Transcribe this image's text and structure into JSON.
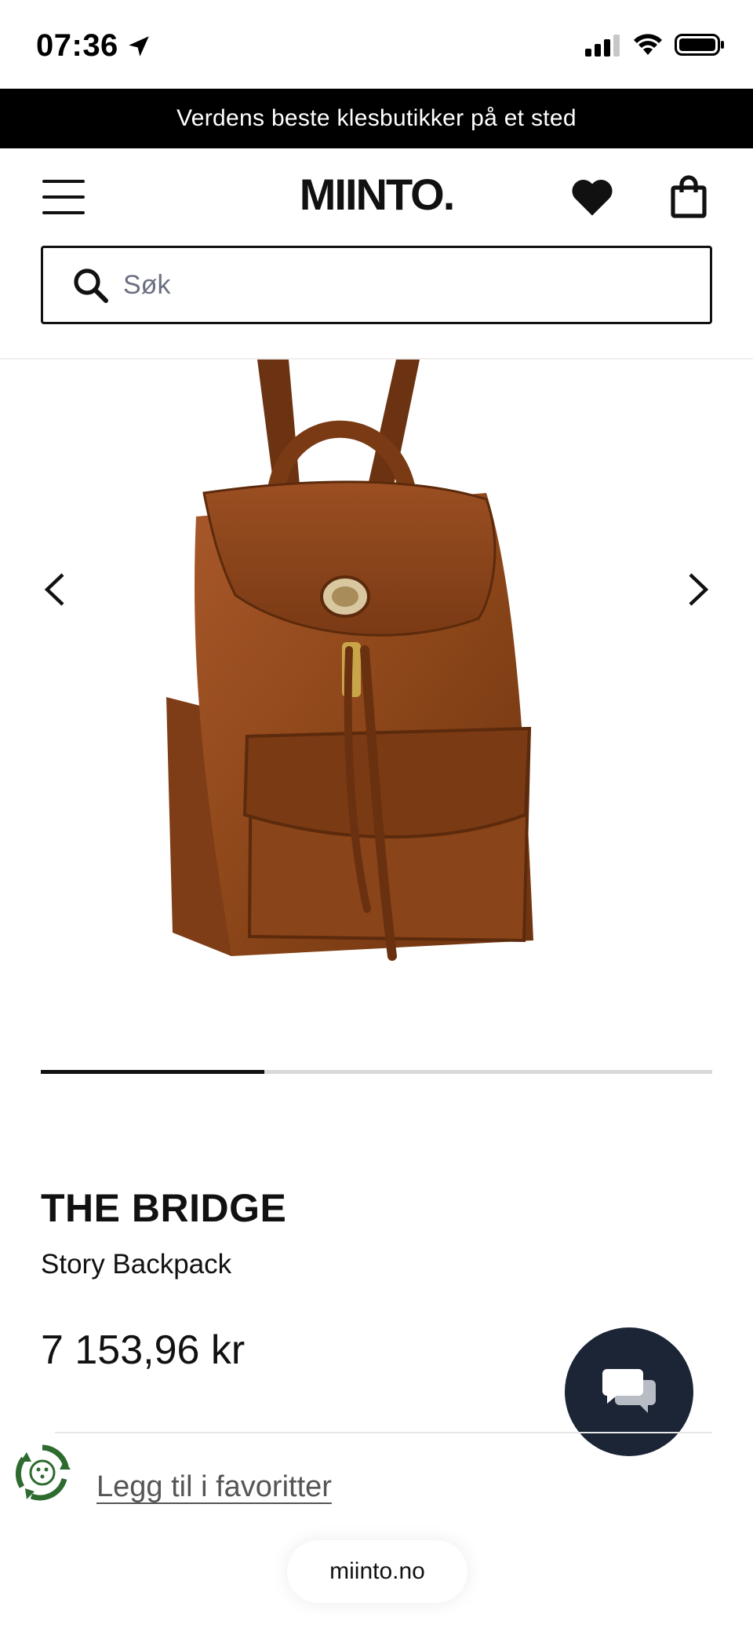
{
  "status_bar": {
    "time": "07:36",
    "icons": [
      "location-arrow-icon",
      "cellular-signal-icon",
      "wifi-icon",
      "battery-icon"
    ]
  },
  "promo_banner": {
    "text": "Verdens beste klesbutikker på et sted"
  },
  "header": {
    "logo": "MIINTO.",
    "icons": [
      "menu-icon",
      "heart-icon",
      "shopping-bag-icon"
    ]
  },
  "search": {
    "placeholder": "Søk",
    "value": ""
  },
  "gallery": {
    "image_description_icon": "backpack-image",
    "progress": 0.333,
    "icons": [
      "chevron-left-icon",
      "chevron-right-icon"
    ]
  },
  "product": {
    "brand": "THE BRIDGE",
    "name": "Story Backpack",
    "price": "7 153,96 kr"
  },
  "actions": {
    "favorite_label": "Legg til i favoritter"
  },
  "browser": {
    "url": "miinto.no"
  },
  "colors": {
    "banner_bg": "#000000",
    "chat_bg": "#1c2536",
    "eco_green": "#2e6b2f",
    "text": "#111111"
  }
}
